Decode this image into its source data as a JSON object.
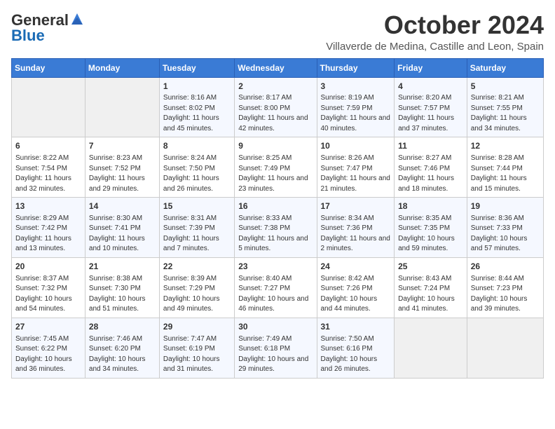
{
  "header": {
    "logo_general": "General",
    "logo_blue": "Blue",
    "month": "October 2024",
    "location": "Villaverde de Medina, Castille and Leon, Spain"
  },
  "days_of_week": [
    "Sunday",
    "Monday",
    "Tuesday",
    "Wednesday",
    "Thursday",
    "Friday",
    "Saturday"
  ],
  "weeks": [
    [
      {
        "day": "",
        "sunrise": "",
        "sunset": "",
        "daylight": "",
        "empty": true
      },
      {
        "day": "",
        "sunrise": "",
        "sunset": "",
        "daylight": "",
        "empty": true
      },
      {
        "day": "1",
        "sunrise": "Sunrise: 8:16 AM",
        "sunset": "Sunset: 8:02 PM",
        "daylight": "Daylight: 11 hours and 45 minutes.",
        "empty": false
      },
      {
        "day": "2",
        "sunrise": "Sunrise: 8:17 AM",
        "sunset": "Sunset: 8:00 PM",
        "daylight": "Daylight: 11 hours and 42 minutes.",
        "empty": false
      },
      {
        "day": "3",
        "sunrise": "Sunrise: 8:19 AM",
        "sunset": "Sunset: 7:59 PM",
        "daylight": "Daylight: 11 hours and 40 minutes.",
        "empty": false
      },
      {
        "day": "4",
        "sunrise": "Sunrise: 8:20 AM",
        "sunset": "Sunset: 7:57 PM",
        "daylight": "Daylight: 11 hours and 37 minutes.",
        "empty": false
      },
      {
        "day": "5",
        "sunrise": "Sunrise: 8:21 AM",
        "sunset": "Sunset: 7:55 PM",
        "daylight": "Daylight: 11 hours and 34 minutes.",
        "empty": false
      }
    ],
    [
      {
        "day": "6",
        "sunrise": "Sunrise: 8:22 AM",
        "sunset": "Sunset: 7:54 PM",
        "daylight": "Daylight: 11 hours and 32 minutes.",
        "empty": false
      },
      {
        "day": "7",
        "sunrise": "Sunrise: 8:23 AM",
        "sunset": "Sunset: 7:52 PM",
        "daylight": "Daylight: 11 hours and 29 minutes.",
        "empty": false
      },
      {
        "day": "8",
        "sunrise": "Sunrise: 8:24 AM",
        "sunset": "Sunset: 7:50 PM",
        "daylight": "Daylight: 11 hours and 26 minutes.",
        "empty": false
      },
      {
        "day": "9",
        "sunrise": "Sunrise: 8:25 AM",
        "sunset": "Sunset: 7:49 PM",
        "daylight": "Daylight: 11 hours and 23 minutes.",
        "empty": false
      },
      {
        "day": "10",
        "sunrise": "Sunrise: 8:26 AM",
        "sunset": "Sunset: 7:47 PM",
        "daylight": "Daylight: 11 hours and 21 minutes.",
        "empty": false
      },
      {
        "day": "11",
        "sunrise": "Sunrise: 8:27 AM",
        "sunset": "Sunset: 7:46 PM",
        "daylight": "Daylight: 11 hours and 18 minutes.",
        "empty": false
      },
      {
        "day": "12",
        "sunrise": "Sunrise: 8:28 AM",
        "sunset": "Sunset: 7:44 PM",
        "daylight": "Daylight: 11 hours and 15 minutes.",
        "empty": false
      }
    ],
    [
      {
        "day": "13",
        "sunrise": "Sunrise: 8:29 AM",
        "sunset": "Sunset: 7:42 PM",
        "daylight": "Daylight: 11 hours and 13 minutes.",
        "empty": false
      },
      {
        "day": "14",
        "sunrise": "Sunrise: 8:30 AM",
        "sunset": "Sunset: 7:41 PM",
        "daylight": "Daylight: 11 hours and 10 minutes.",
        "empty": false
      },
      {
        "day": "15",
        "sunrise": "Sunrise: 8:31 AM",
        "sunset": "Sunset: 7:39 PM",
        "daylight": "Daylight: 11 hours and 7 minutes.",
        "empty": false
      },
      {
        "day": "16",
        "sunrise": "Sunrise: 8:33 AM",
        "sunset": "Sunset: 7:38 PM",
        "daylight": "Daylight: 11 hours and 5 minutes.",
        "empty": false
      },
      {
        "day": "17",
        "sunrise": "Sunrise: 8:34 AM",
        "sunset": "Sunset: 7:36 PM",
        "daylight": "Daylight: 11 hours and 2 minutes.",
        "empty": false
      },
      {
        "day": "18",
        "sunrise": "Sunrise: 8:35 AM",
        "sunset": "Sunset: 7:35 PM",
        "daylight": "Daylight: 10 hours and 59 minutes.",
        "empty": false
      },
      {
        "day": "19",
        "sunrise": "Sunrise: 8:36 AM",
        "sunset": "Sunset: 7:33 PM",
        "daylight": "Daylight: 10 hours and 57 minutes.",
        "empty": false
      }
    ],
    [
      {
        "day": "20",
        "sunrise": "Sunrise: 8:37 AM",
        "sunset": "Sunset: 7:32 PM",
        "daylight": "Daylight: 10 hours and 54 minutes.",
        "empty": false
      },
      {
        "day": "21",
        "sunrise": "Sunrise: 8:38 AM",
        "sunset": "Sunset: 7:30 PM",
        "daylight": "Daylight: 10 hours and 51 minutes.",
        "empty": false
      },
      {
        "day": "22",
        "sunrise": "Sunrise: 8:39 AM",
        "sunset": "Sunset: 7:29 PM",
        "daylight": "Daylight: 10 hours and 49 minutes.",
        "empty": false
      },
      {
        "day": "23",
        "sunrise": "Sunrise: 8:40 AM",
        "sunset": "Sunset: 7:27 PM",
        "daylight": "Daylight: 10 hours and 46 minutes.",
        "empty": false
      },
      {
        "day": "24",
        "sunrise": "Sunrise: 8:42 AM",
        "sunset": "Sunset: 7:26 PM",
        "daylight": "Daylight: 10 hours and 44 minutes.",
        "empty": false
      },
      {
        "day": "25",
        "sunrise": "Sunrise: 8:43 AM",
        "sunset": "Sunset: 7:24 PM",
        "daylight": "Daylight: 10 hours and 41 minutes.",
        "empty": false
      },
      {
        "day": "26",
        "sunrise": "Sunrise: 8:44 AM",
        "sunset": "Sunset: 7:23 PM",
        "daylight": "Daylight: 10 hours and 39 minutes.",
        "empty": false
      }
    ],
    [
      {
        "day": "27",
        "sunrise": "Sunrise: 7:45 AM",
        "sunset": "Sunset: 6:22 PM",
        "daylight": "Daylight: 10 hours and 36 minutes.",
        "empty": false
      },
      {
        "day": "28",
        "sunrise": "Sunrise: 7:46 AM",
        "sunset": "Sunset: 6:20 PM",
        "daylight": "Daylight: 10 hours and 34 minutes.",
        "empty": false
      },
      {
        "day": "29",
        "sunrise": "Sunrise: 7:47 AM",
        "sunset": "Sunset: 6:19 PM",
        "daylight": "Daylight: 10 hours and 31 minutes.",
        "empty": false
      },
      {
        "day": "30",
        "sunrise": "Sunrise: 7:49 AM",
        "sunset": "Sunset: 6:18 PM",
        "daylight": "Daylight: 10 hours and 29 minutes.",
        "empty": false
      },
      {
        "day": "31",
        "sunrise": "Sunrise: 7:50 AM",
        "sunset": "Sunset: 6:16 PM",
        "daylight": "Daylight: 10 hours and 26 minutes.",
        "empty": false
      },
      {
        "day": "",
        "sunrise": "",
        "sunset": "",
        "daylight": "",
        "empty": true
      },
      {
        "day": "",
        "sunrise": "",
        "sunset": "",
        "daylight": "",
        "empty": true
      }
    ]
  ]
}
